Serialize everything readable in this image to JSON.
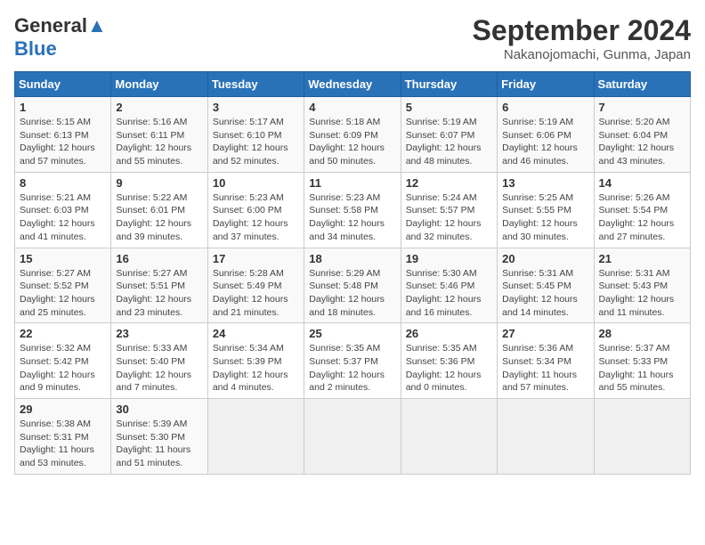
{
  "logo": {
    "line1": "General",
    "line2": "Blue"
  },
  "title": "September 2024",
  "subtitle": "Nakanojomachi, Gunma, Japan",
  "weekdays": [
    "Sunday",
    "Monday",
    "Tuesday",
    "Wednesday",
    "Thursday",
    "Friday",
    "Saturday"
  ],
  "weeks": [
    [
      {
        "day": 1,
        "info": "Sunrise: 5:15 AM\nSunset: 6:13 PM\nDaylight: 12 hours\nand 57 minutes."
      },
      {
        "day": 2,
        "info": "Sunrise: 5:16 AM\nSunset: 6:11 PM\nDaylight: 12 hours\nand 55 minutes."
      },
      {
        "day": 3,
        "info": "Sunrise: 5:17 AM\nSunset: 6:10 PM\nDaylight: 12 hours\nand 52 minutes."
      },
      {
        "day": 4,
        "info": "Sunrise: 5:18 AM\nSunset: 6:09 PM\nDaylight: 12 hours\nand 50 minutes."
      },
      {
        "day": 5,
        "info": "Sunrise: 5:19 AM\nSunset: 6:07 PM\nDaylight: 12 hours\nand 48 minutes."
      },
      {
        "day": 6,
        "info": "Sunrise: 5:19 AM\nSunset: 6:06 PM\nDaylight: 12 hours\nand 46 minutes."
      },
      {
        "day": 7,
        "info": "Sunrise: 5:20 AM\nSunset: 6:04 PM\nDaylight: 12 hours\nand 43 minutes."
      }
    ],
    [
      {
        "day": 8,
        "info": "Sunrise: 5:21 AM\nSunset: 6:03 PM\nDaylight: 12 hours\nand 41 minutes."
      },
      {
        "day": 9,
        "info": "Sunrise: 5:22 AM\nSunset: 6:01 PM\nDaylight: 12 hours\nand 39 minutes."
      },
      {
        "day": 10,
        "info": "Sunrise: 5:23 AM\nSunset: 6:00 PM\nDaylight: 12 hours\nand 37 minutes."
      },
      {
        "day": 11,
        "info": "Sunrise: 5:23 AM\nSunset: 5:58 PM\nDaylight: 12 hours\nand 34 minutes."
      },
      {
        "day": 12,
        "info": "Sunrise: 5:24 AM\nSunset: 5:57 PM\nDaylight: 12 hours\nand 32 minutes."
      },
      {
        "day": 13,
        "info": "Sunrise: 5:25 AM\nSunset: 5:55 PM\nDaylight: 12 hours\nand 30 minutes."
      },
      {
        "day": 14,
        "info": "Sunrise: 5:26 AM\nSunset: 5:54 PM\nDaylight: 12 hours\nand 27 minutes."
      }
    ],
    [
      {
        "day": 15,
        "info": "Sunrise: 5:27 AM\nSunset: 5:52 PM\nDaylight: 12 hours\nand 25 minutes."
      },
      {
        "day": 16,
        "info": "Sunrise: 5:27 AM\nSunset: 5:51 PM\nDaylight: 12 hours\nand 23 minutes."
      },
      {
        "day": 17,
        "info": "Sunrise: 5:28 AM\nSunset: 5:49 PM\nDaylight: 12 hours\nand 21 minutes."
      },
      {
        "day": 18,
        "info": "Sunrise: 5:29 AM\nSunset: 5:48 PM\nDaylight: 12 hours\nand 18 minutes."
      },
      {
        "day": 19,
        "info": "Sunrise: 5:30 AM\nSunset: 5:46 PM\nDaylight: 12 hours\nand 16 minutes."
      },
      {
        "day": 20,
        "info": "Sunrise: 5:31 AM\nSunset: 5:45 PM\nDaylight: 12 hours\nand 14 minutes."
      },
      {
        "day": 21,
        "info": "Sunrise: 5:31 AM\nSunset: 5:43 PM\nDaylight: 12 hours\nand 11 minutes."
      }
    ],
    [
      {
        "day": 22,
        "info": "Sunrise: 5:32 AM\nSunset: 5:42 PM\nDaylight: 12 hours\nand 9 minutes."
      },
      {
        "day": 23,
        "info": "Sunrise: 5:33 AM\nSunset: 5:40 PM\nDaylight: 12 hours\nand 7 minutes."
      },
      {
        "day": 24,
        "info": "Sunrise: 5:34 AM\nSunset: 5:39 PM\nDaylight: 12 hours\nand 4 minutes."
      },
      {
        "day": 25,
        "info": "Sunrise: 5:35 AM\nSunset: 5:37 PM\nDaylight: 12 hours\nand 2 minutes."
      },
      {
        "day": 26,
        "info": "Sunrise: 5:35 AM\nSunset: 5:36 PM\nDaylight: 12 hours\nand 0 minutes."
      },
      {
        "day": 27,
        "info": "Sunrise: 5:36 AM\nSunset: 5:34 PM\nDaylight: 11 hours\nand 57 minutes."
      },
      {
        "day": 28,
        "info": "Sunrise: 5:37 AM\nSunset: 5:33 PM\nDaylight: 11 hours\nand 55 minutes."
      }
    ],
    [
      {
        "day": 29,
        "info": "Sunrise: 5:38 AM\nSunset: 5:31 PM\nDaylight: 11 hours\nand 53 minutes."
      },
      {
        "day": 30,
        "info": "Sunrise: 5:39 AM\nSunset: 5:30 PM\nDaylight: 11 hours\nand 51 minutes."
      },
      {
        "day": null,
        "info": ""
      },
      {
        "day": null,
        "info": ""
      },
      {
        "day": null,
        "info": ""
      },
      {
        "day": null,
        "info": ""
      },
      {
        "day": null,
        "info": ""
      }
    ]
  ]
}
